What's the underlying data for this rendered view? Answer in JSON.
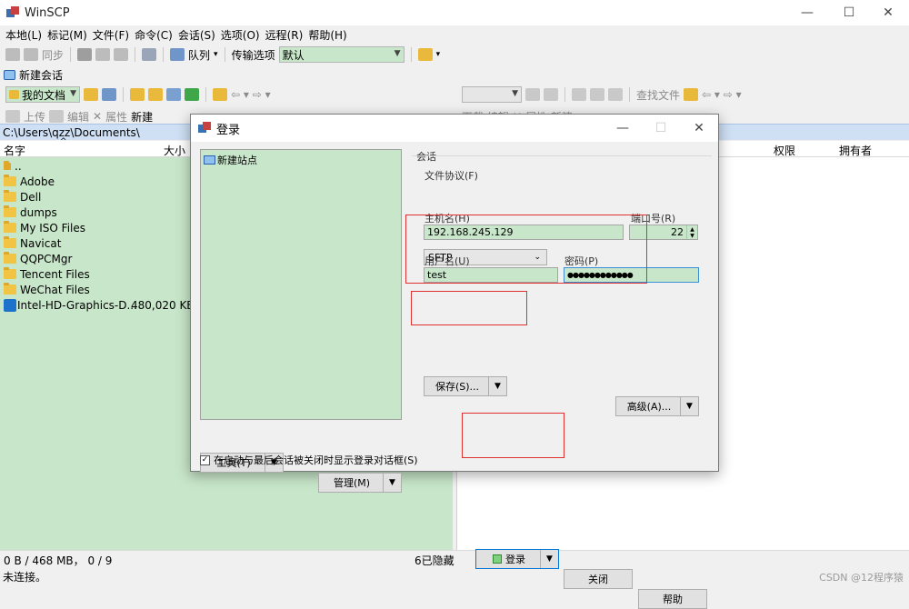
{
  "window": {
    "title": "WinSCP",
    "minimize": "—",
    "maximize": "☐",
    "close": "✕"
  },
  "menu": [
    "本地(L)",
    "标记(M)",
    "文件(F)",
    "命令(C)",
    "会话(S)",
    "选项(O)",
    "远程(R)",
    "帮助(H)"
  ],
  "toolbar": {
    "sync": "同步",
    "queue": "队列",
    "transfer_label": "传输选项",
    "transfer_value": "默认"
  },
  "session": {
    "new_session": "新建会话"
  },
  "local": {
    "location": "我的文档",
    "upload": "上传",
    "edit": "编辑",
    "properties": "属性",
    "new": "新建",
    "path": "C:\\Users\\qzz\\Documents\\",
    "col_name": "名字",
    "col_size": "大小",
    "files": [
      {
        "name": "..",
        "size": "",
        "type": "up"
      },
      {
        "name": "Adobe",
        "size": "",
        "type": "folder"
      },
      {
        "name": "Dell",
        "size": "",
        "type": "folder"
      },
      {
        "name": "dumps",
        "size": "",
        "type": "folder"
      },
      {
        "name": "My ISO Files",
        "size": "",
        "type": "folder"
      },
      {
        "name": "Navicat",
        "size": "",
        "type": "folder"
      },
      {
        "name": "QQPCMgr",
        "size": "",
        "type": "folder"
      },
      {
        "name": "Tencent Files",
        "size": "",
        "type": "folder"
      },
      {
        "name": "WeChat Files",
        "size": "",
        "type": "folder"
      },
      {
        "name": "Intel-HD-Graphics-D...",
        "size": "480,020 KB",
        "type": "exe"
      }
    ],
    "status_size": "0 B / 468 MB，  0 / 9",
    "status_hidden": "6已隐藏"
  },
  "remote": {
    "find_files": "查找文件",
    "download": "下载",
    "edit": "编辑",
    "properties": "属性",
    "new": "新建",
    "col_permissions": "权限",
    "col_owner": "拥有者"
  },
  "status": {
    "connection": "未连接。"
  },
  "login_dialog": {
    "title": "登录",
    "site_new": "新建站点",
    "group_session": "会话",
    "protocol_label": "文件协议(F)",
    "protocol_value": "SFTP",
    "host_label": "主机名(H)",
    "host_value": "192.168.245.129",
    "port_label": "端口号(R)",
    "port_value": "22",
    "user_label": "用户名(U)",
    "user_value": "test",
    "password_label": "密码(P)",
    "password_value": "●●●●●●●●●●●●",
    "save_button": "保存(S)...",
    "advanced_button": "高级(A)...",
    "tools_button": "工具(T)",
    "manage_button": "管理(M)",
    "login_button": "登录",
    "close_button": "关闭",
    "help_button": "帮助",
    "checkbox_label": "在启动与最后会话被关闭时显示登录对话框(S)",
    "checkbox_checked": "✓"
  },
  "watermark": "CSDN @12程序猿",
  "colors": {
    "highlight_green": "#c8e6c9",
    "path_blue": "#cfe0f5",
    "annotation_red": "#e03131",
    "folder": "#f2c443"
  }
}
